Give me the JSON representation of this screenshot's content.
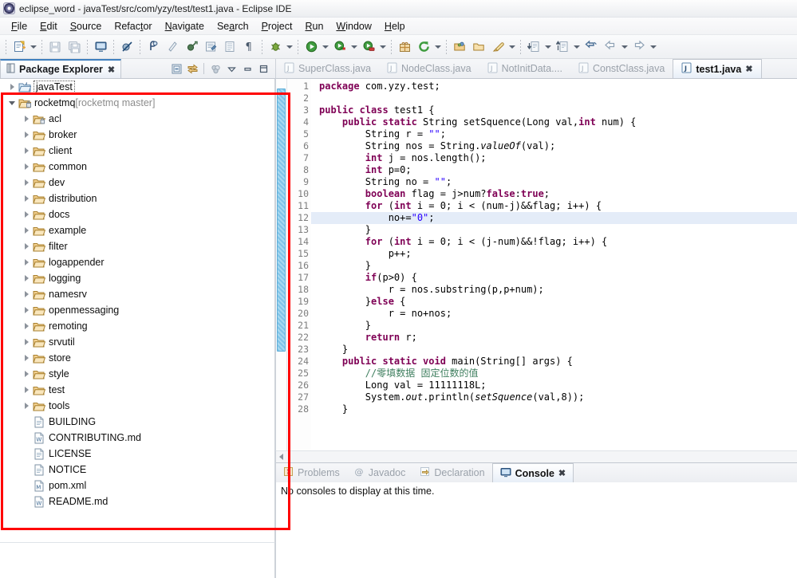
{
  "window": {
    "title": "eclipse_word - javaTest/src/com/yzy/test/test1.java - Eclipse IDE",
    "app_icon": "eclipse-icon"
  },
  "menubar": [
    {
      "label": "File",
      "mnemonic": "F"
    },
    {
      "label": "Edit",
      "mnemonic": "E"
    },
    {
      "label": "Source",
      "mnemonic": "S"
    },
    {
      "label": "Refactor",
      "mnemonic": "t"
    },
    {
      "label": "Navigate",
      "mnemonic": "N"
    },
    {
      "label": "Search",
      "mnemonic": "a"
    },
    {
      "label": "Project",
      "mnemonic": "P"
    },
    {
      "label": "Run",
      "mnemonic": "R"
    },
    {
      "label": "Window",
      "mnemonic": "W"
    },
    {
      "label": "Help",
      "mnemonic": "H"
    }
  ],
  "toolbar": {
    "groups": [
      {
        "items": [
          {
            "name": "new-wizard-icon",
            "label": "New"
          },
          {
            "name": "new-dropdown-caret",
            "label": ""
          }
        ]
      },
      {
        "items": [
          {
            "name": "save-icon",
            "label": "Save"
          },
          {
            "name": "save-all-icon",
            "label": "Save All"
          }
        ]
      },
      {
        "items": [
          {
            "name": "open-console-icon",
            "label": "Open Console"
          }
        ]
      },
      {
        "items": [
          {
            "name": "skip-breakpoints-icon",
            "label": "Skip All Breakpoints"
          }
        ]
      },
      {
        "items": [
          {
            "name": "toggle-mark-occurrences-icon",
            "label": "Toggle Mark Occurrences"
          },
          {
            "name": "new-java-package-icon",
            "label": "New Java Package"
          },
          {
            "name": "new-java-class-icon",
            "label": "New Java Class"
          },
          {
            "name": "external-tools-icon",
            "label": "External Tools"
          },
          {
            "name": "open-task-icon",
            "label": "Open Task"
          },
          {
            "name": "show-whitespace-icon",
            "label": "Show Whitespace Characters"
          }
        ]
      },
      {
        "items": [
          {
            "name": "debug-icon",
            "label": "Debug"
          },
          {
            "name": "debug-dropdown-caret",
            "label": ""
          }
        ]
      },
      {
        "items": [
          {
            "name": "run-icon",
            "label": "Run"
          },
          {
            "name": "run-dropdown-caret",
            "label": ""
          },
          {
            "name": "run-external-tools-icon",
            "label": "Run External Tools"
          },
          {
            "name": "run-external-caret",
            "label": ""
          },
          {
            "name": "coverage-icon",
            "label": "Coverage"
          },
          {
            "name": "coverage-caret",
            "label": ""
          }
        ]
      },
      {
        "items": [
          {
            "name": "new-package-gift-icon",
            "label": "New Package"
          },
          {
            "name": "refresh-icon",
            "label": "Refresh"
          },
          {
            "name": "refresh-caret",
            "label": ""
          }
        ]
      },
      {
        "items": [
          {
            "name": "open-type-icon",
            "label": "Open Type"
          },
          {
            "name": "open-resource-icon",
            "label": "Open Resource"
          },
          {
            "name": "quick-fix-icon",
            "label": "Quick Fix"
          },
          {
            "name": "quick-fix-caret",
            "label": ""
          }
        ]
      },
      {
        "items": [
          {
            "name": "next-annotation-icon",
            "label": "Next Annotation"
          },
          {
            "name": "next-annotation-caret",
            "label": ""
          },
          {
            "name": "previous-annotation-icon",
            "label": "Previous Annotation"
          },
          {
            "name": "previous-annotation-caret",
            "label": ""
          },
          {
            "name": "last-edit-location-icon",
            "label": "Back to Last Edit Location"
          },
          {
            "name": "back-icon",
            "label": "Back"
          },
          {
            "name": "back-caret",
            "label": ""
          },
          {
            "name": "forward-icon",
            "label": "Forward"
          },
          {
            "name": "forward-caret",
            "label": ""
          }
        ]
      }
    ]
  },
  "package_explorer": {
    "tab_label": "Package Explorer",
    "close_label": "✖",
    "toolbar": [
      {
        "name": "collapse-all-icon",
        "label": "Collapse All"
      },
      {
        "name": "link-with-editor-icon",
        "label": "Link with Editor"
      },
      {
        "name": "focus-on-active-task-icon",
        "label": "Focus on Active Task"
      },
      {
        "name": "view-menu-icon",
        "label": "View Menu"
      },
      {
        "name": "minimize-icon",
        "label": "Minimize"
      },
      {
        "name": "maximize-icon",
        "label": "Maximize"
      }
    ],
    "tree": [
      {
        "label": "javaTest",
        "sub": "",
        "indent": 0,
        "arrow": "closed",
        "icon": "java-project-icon",
        "selected": true
      },
      {
        "label": "rocketmq",
        "sub": " [rocketmq master]",
        "indent": 0,
        "arrow": "open",
        "icon": "project-repo-icon",
        "selected": false
      },
      {
        "label": "acl",
        "sub": "",
        "indent": 1,
        "arrow": "closed",
        "icon": "folder-lock-icon",
        "selected": false
      },
      {
        "label": "broker",
        "sub": "",
        "indent": 1,
        "arrow": "closed",
        "icon": "folder-icon",
        "selected": false
      },
      {
        "label": "client",
        "sub": "",
        "indent": 1,
        "arrow": "closed",
        "icon": "folder-icon",
        "selected": false
      },
      {
        "label": "common",
        "sub": "",
        "indent": 1,
        "arrow": "closed",
        "icon": "folder-icon",
        "selected": false
      },
      {
        "label": "dev",
        "sub": "",
        "indent": 1,
        "arrow": "closed",
        "icon": "folder-icon",
        "selected": false
      },
      {
        "label": "distribution",
        "sub": "",
        "indent": 1,
        "arrow": "closed",
        "icon": "folder-icon",
        "selected": false
      },
      {
        "label": "docs",
        "sub": "",
        "indent": 1,
        "arrow": "closed",
        "icon": "folder-icon",
        "selected": false
      },
      {
        "label": "example",
        "sub": "",
        "indent": 1,
        "arrow": "closed",
        "icon": "folder-icon",
        "selected": false
      },
      {
        "label": "filter",
        "sub": "",
        "indent": 1,
        "arrow": "closed",
        "icon": "folder-icon",
        "selected": false
      },
      {
        "label": "logappender",
        "sub": "",
        "indent": 1,
        "arrow": "closed",
        "icon": "folder-icon",
        "selected": false
      },
      {
        "label": "logging",
        "sub": "",
        "indent": 1,
        "arrow": "closed",
        "icon": "folder-icon",
        "selected": false
      },
      {
        "label": "namesrv",
        "sub": "",
        "indent": 1,
        "arrow": "closed",
        "icon": "folder-icon",
        "selected": false
      },
      {
        "label": "openmessaging",
        "sub": "",
        "indent": 1,
        "arrow": "closed",
        "icon": "folder-icon",
        "selected": false
      },
      {
        "label": "remoting",
        "sub": "",
        "indent": 1,
        "arrow": "closed",
        "icon": "folder-icon",
        "selected": false
      },
      {
        "label": "srvutil",
        "sub": "",
        "indent": 1,
        "arrow": "closed",
        "icon": "folder-icon",
        "selected": false
      },
      {
        "label": "store",
        "sub": "",
        "indent": 1,
        "arrow": "closed",
        "icon": "folder-icon",
        "selected": false
      },
      {
        "label": "style",
        "sub": "",
        "indent": 1,
        "arrow": "closed",
        "icon": "folder-icon",
        "selected": false
      },
      {
        "label": "test",
        "sub": "",
        "indent": 1,
        "arrow": "closed",
        "icon": "folder-icon",
        "selected": false
      },
      {
        "label": "tools",
        "sub": "",
        "indent": 1,
        "arrow": "closed",
        "icon": "folder-icon",
        "selected": false
      },
      {
        "label": "BUILDING",
        "sub": "",
        "indent": 1,
        "arrow": "none",
        "icon": "file-icon",
        "selected": false
      },
      {
        "label": "CONTRIBUTING.md",
        "sub": "",
        "indent": 1,
        "arrow": "none",
        "icon": "markdown-file-icon",
        "selected": false
      },
      {
        "label": "LICENSE",
        "sub": "",
        "indent": 1,
        "arrow": "none",
        "icon": "file-icon",
        "selected": false
      },
      {
        "label": "NOTICE",
        "sub": "",
        "indent": 1,
        "arrow": "none",
        "icon": "file-icon",
        "selected": false
      },
      {
        "label": "pom.xml",
        "sub": "",
        "indent": 1,
        "arrow": "none",
        "icon": "maven-file-icon",
        "selected": false
      },
      {
        "label": "README.md",
        "sub": "",
        "indent": 1,
        "arrow": "none",
        "icon": "markdown-file-icon",
        "selected": false
      }
    ]
  },
  "editor": {
    "tabs": [
      {
        "label": "SuperClass.java",
        "active": false,
        "closable": false
      },
      {
        "label": "NodeClass.java",
        "active": false,
        "closable": false
      },
      {
        "label": "NotInitData....",
        "active": false,
        "closable": false
      },
      {
        "label": "ConstClass.java",
        "active": false,
        "closable": false
      },
      {
        "label": "test1.java",
        "active": true,
        "closable": true
      }
    ],
    "close_label": "✖",
    "first_line_number": 1,
    "highlighted_line": 12,
    "fold_lines": [
      4,
      24
    ],
    "lines": [
      {
        "n": 1,
        "tokens": [
          {
            "t": "kw",
            "v": "package"
          },
          {
            "t": "p",
            "v": " com.yzy.test;"
          }
        ]
      },
      {
        "n": 2,
        "tokens": []
      },
      {
        "n": 3,
        "tokens": [
          {
            "t": "kw",
            "v": "public class"
          },
          {
            "t": "p",
            "v": " test1 {"
          }
        ]
      },
      {
        "n": 4,
        "tokens": [
          {
            "t": "p",
            "v": "    "
          },
          {
            "t": "kw",
            "v": "public static"
          },
          {
            "t": "p",
            "v": " String setSquence(Long val,"
          },
          {
            "t": "kw",
            "v": "int"
          },
          {
            "t": "p",
            "v": " num) {"
          }
        ]
      },
      {
        "n": 5,
        "tokens": [
          {
            "t": "p",
            "v": "        String r = "
          },
          {
            "t": "str",
            "v": "\"\""
          },
          {
            "t": "p",
            "v": ";"
          }
        ]
      },
      {
        "n": 6,
        "tokens": [
          {
            "t": "p",
            "v": "        String nos = String."
          },
          {
            "t": "stat",
            "v": "valueOf"
          },
          {
            "t": "p",
            "v": "(val);"
          }
        ]
      },
      {
        "n": 7,
        "tokens": [
          {
            "t": "p",
            "v": "        "
          },
          {
            "t": "kw",
            "v": "int"
          },
          {
            "t": "p",
            "v": " j = nos.length();"
          }
        ]
      },
      {
        "n": 8,
        "tokens": [
          {
            "t": "p",
            "v": "        "
          },
          {
            "t": "kw",
            "v": "int"
          },
          {
            "t": "p",
            "v": " p=0;"
          }
        ]
      },
      {
        "n": 9,
        "tokens": [
          {
            "t": "p",
            "v": "        String no = "
          },
          {
            "t": "str",
            "v": "\"\""
          },
          {
            "t": "p",
            "v": ";"
          }
        ]
      },
      {
        "n": 10,
        "tokens": [
          {
            "t": "p",
            "v": "        "
          },
          {
            "t": "kw",
            "v": "boolean"
          },
          {
            "t": "p",
            "v": " flag = j>num?"
          },
          {
            "t": "kw",
            "v": "false"
          },
          {
            "t": "p",
            "v": ":"
          },
          {
            "t": "kw",
            "v": "true"
          },
          {
            "t": "p",
            "v": ";"
          }
        ]
      },
      {
        "n": 11,
        "tokens": [
          {
            "t": "p",
            "v": "        "
          },
          {
            "t": "kw",
            "v": "for"
          },
          {
            "t": "p",
            "v": " ("
          },
          {
            "t": "kw",
            "v": "int"
          },
          {
            "t": "p",
            "v": " i = 0; i < (num-j)&&flag; i++) {"
          }
        ]
      },
      {
        "n": 12,
        "tokens": [
          {
            "t": "p",
            "v": "            no+="
          },
          {
            "t": "str",
            "v": "\"0\""
          },
          {
            "t": "p",
            "v": ";"
          }
        ]
      },
      {
        "n": 13,
        "tokens": [
          {
            "t": "p",
            "v": "        }"
          }
        ]
      },
      {
        "n": 14,
        "tokens": [
          {
            "t": "p",
            "v": "        "
          },
          {
            "t": "kw",
            "v": "for"
          },
          {
            "t": "p",
            "v": " ("
          },
          {
            "t": "kw",
            "v": "int"
          },
          {
            "t": "p",
            "v": " i = 0; i < (j-num)&&!flag; i++) {"
          }
        ]
      },
      {
        "n": 15,
        "tokens": [
          {
            "t": "p",
            "v": "            p++;"
          }
        ]
      },
      {
        "n": 16,
        "tokens": [
          {
            "t": "p",
            "v": "        }"
          }
        ]
      },
      {
        "n": 17,
        "tokens": [
          {
            "t": "p",
            "v": "        "
          },
          {
            "t": "kw",
            "v": "if"
          },
          {
            "t": "p",
            "v": "(p>0) {"
          }
        ]
      },
      {
        "n": 18,
        "tokens": [
          {
            "t": "p",
            "v": "            r = nos.substring(p,p+num);"
          }
        ]
      },
      {
        "n": 19,
        "tokens": [
          {
            "t": "p",
            "v": "        }"
          },
          {
            "t": "kw",
            "v": "else"
          },
          {
            "t": "p",
            "v": " {"
          }
        ]
      },
      {
        "n": 20,
        "tokens": [
          {
            "t": "p",
            "v": "            r = no+nos;"
          }
        ]
      },
      {
        "n": 21,
        "tokens": [
          {
            "t": "p",
            "v": "        }"
          }
        ]
      },
      {
        "n": 22,
        "tokens": [
          {
            "t": "p",
            "v": "        "
          },
          {
            "t": "kw",
            "v": "return"
          },
          {
            "t": "p",
            "v": " r;"
          }
        ]
      },
      {
        "n": 23,
        "tokens": [
          {
            "t": "p",
            "v": "    }"
          }
        ]
      },
      {
        "n": 24,
        "tokens": [
          {
            "t": "p",
            "v": "    "
          },
          {
            "t": "kw",
            "v": "public static void"
          },
          {
            "t": "p",
            "v": " main(String[] args) {"
          }
        ]
      },
      {
        "n": 25,
        "tokens": [
          {
            "t": "cmt",
            "v": "        //零填数据 固定位数的值"
          }
        ]
      },
      {
        "n": 26,
        "tokens": [
          {
            "t": "p",
            "v": "        Long val = 11111118L;"
          }
        ]
      },
      {
        "n": 27,
        "tokens": [
          {
            "t": "p",
            "v": "        System."
          },
          {
            "t": "stat",
            "v": "out"
          },
          {
            "t": "p",
            "v": ".println("
          },
          {
            "t": "stat",
            "v": "setSquence"
          },
          {
            "t": "p",
            "v": "(val,8));"
          }
        ]
      },
      {
        "n": 28,
        "tokens": [
          {
            "t": "p",
            "v": "    }"
          }
        ]
      }
    ]
  },
  "bottom_panel": {
    "tabs": [
      {
        "label": "Problems",
        "icon": "problems-icon",
        "active": false,
        "closable": false
      },
      {
        "label": "Javadoc",
        "icon": "javadoc-icon",
        "active": false,
        "closable": false
      },
      {
        "label": "Declaration",
        "icon": "declaration-icon",
        "active": false,
        "closable": false
      },
      {
        "label": "Console",
        "icon": "console-icon",
        "active": true,
        "closable": true
      }
    ],
    "close_label": "✖",
    "console_message": "No consoles to display at this time."
  },
  "annotation": {
    "type": "red-rectangle-highlight",
    "color": "#ff0000"
  },
  "colors": {
    "keyword": "#7f0055",
    "string": "#2a00ff",
    "comment": "#3f7f5f",
    "highlight_line": "#e4ecf8",
    "accent_tab": "#3f7fbf",
    "annotation_red": "#ff0000"
  }
}
